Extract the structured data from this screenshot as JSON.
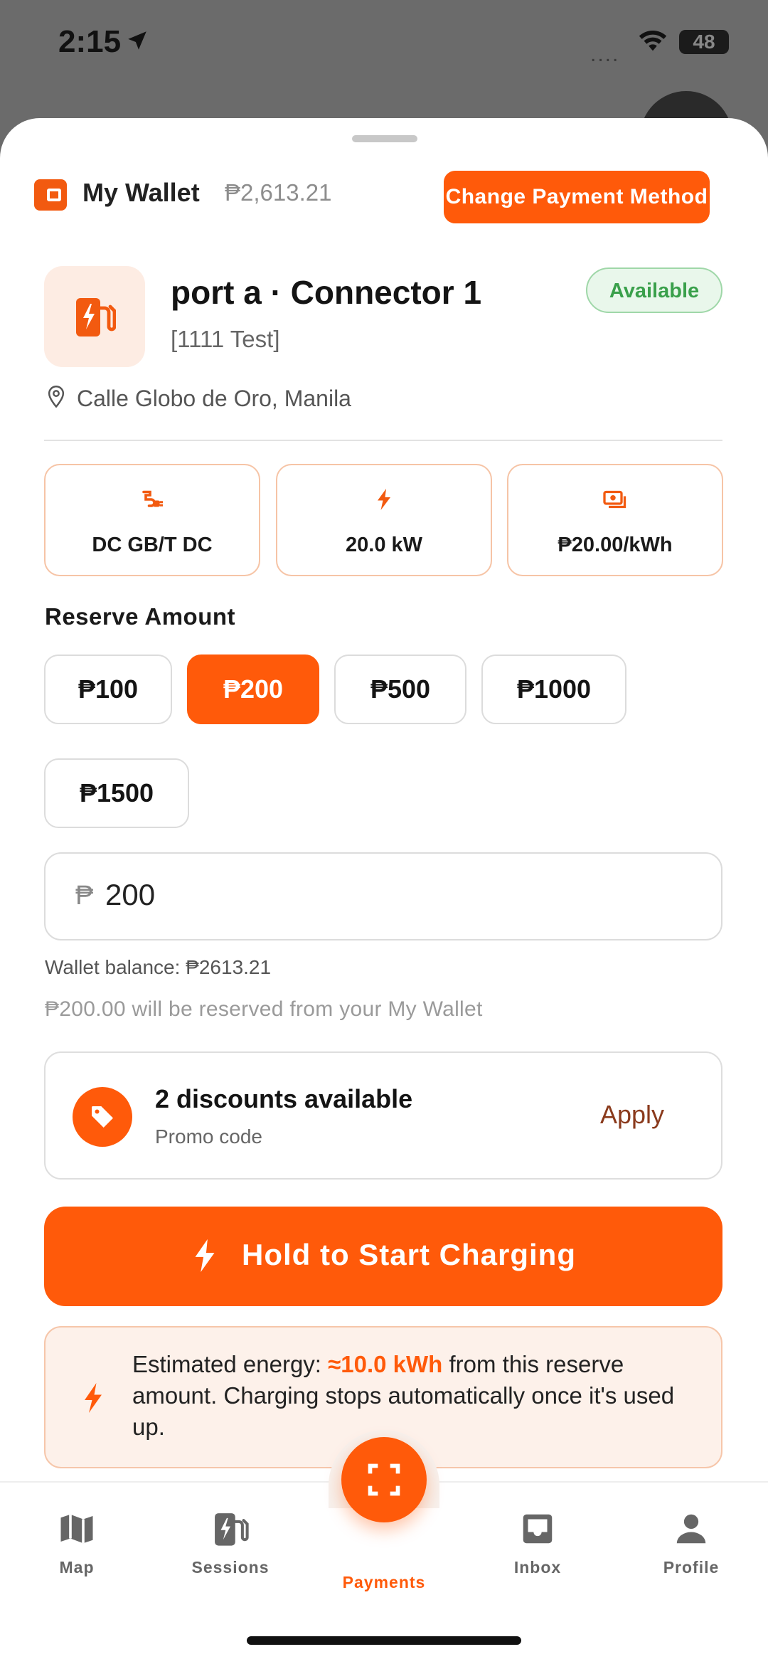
{
  "status_bar": {
    "time": "2:15",
    "signal": "....",
    "battery": "48"
  },
  "wallet": {
    "title": "My Wallet",
    "balance": "₱2,613.21",
    "change_label": "Change Payment Method"
  },
  "charger": {
    "title": "port a · Connector 1",
    "subtitle": "[1111 Test]",
    "status": "Available",
    "location": "Calle Globo de Oro, Manila"
  },
  "specs": [
    {
      "icon": "plug-icon",
      "value": "DC GB/T DC"
    },
    {
      "icon": "bolt-icon",
      "value": "20.0 kW"
    },
    {
      "icon": "cash-icon",
      "value": "₱20.00/kWh"
    }
  ],
  "reserve": {
    "label": "Reserve Amount",
    "options": [
      "₱100",
      "₱200",
      "₱500",
      "₱1000",
      "₱1500"
    ],
    "selected": "₱200",
    "currency_symbol": "₱",
    "input_value": "200",
    "wallet_note": "Wallet balance: ₱2613.21",
    "reserve_note": "₱200.00 will be reserved from your My Wallet"
  },
  "promo": {
    "title": "2 discounts available",
    "subtitle": "Promo code",
    "apply_label": "Apply"
  },
  "start_button": {
    "label": "Hold to Start Charging"
  },
  "info": {
    "prefix": "Estimated energy: ",
    "highlight": "≈10.0 kWh",
    "suffix": " from this reserve amount. Charging stops automatically once it's used up."
  },
  "tabs": [
    {
      "label": "Map",
      "icon": "map-icon"
    },
    {
      "label": "Sessions",
      "icon": "charging-station-icon"
    },
    {
      "label": "Payments",
      "icon": "scan-icon",
      "active": true
    },
    {
      "label": "Inbox",
      "icon": "inbox-icon"
    },
    {
      "label": "Profile",
      "icon": "person-icon"
    }
  ],
  "colors": {
    "accent": "#ff5a0a",
    "available_green": "#3aa04b",
    "available_bg": "#e9f7eb",
    "info_bg": "#fdf1ea"
  }
}
